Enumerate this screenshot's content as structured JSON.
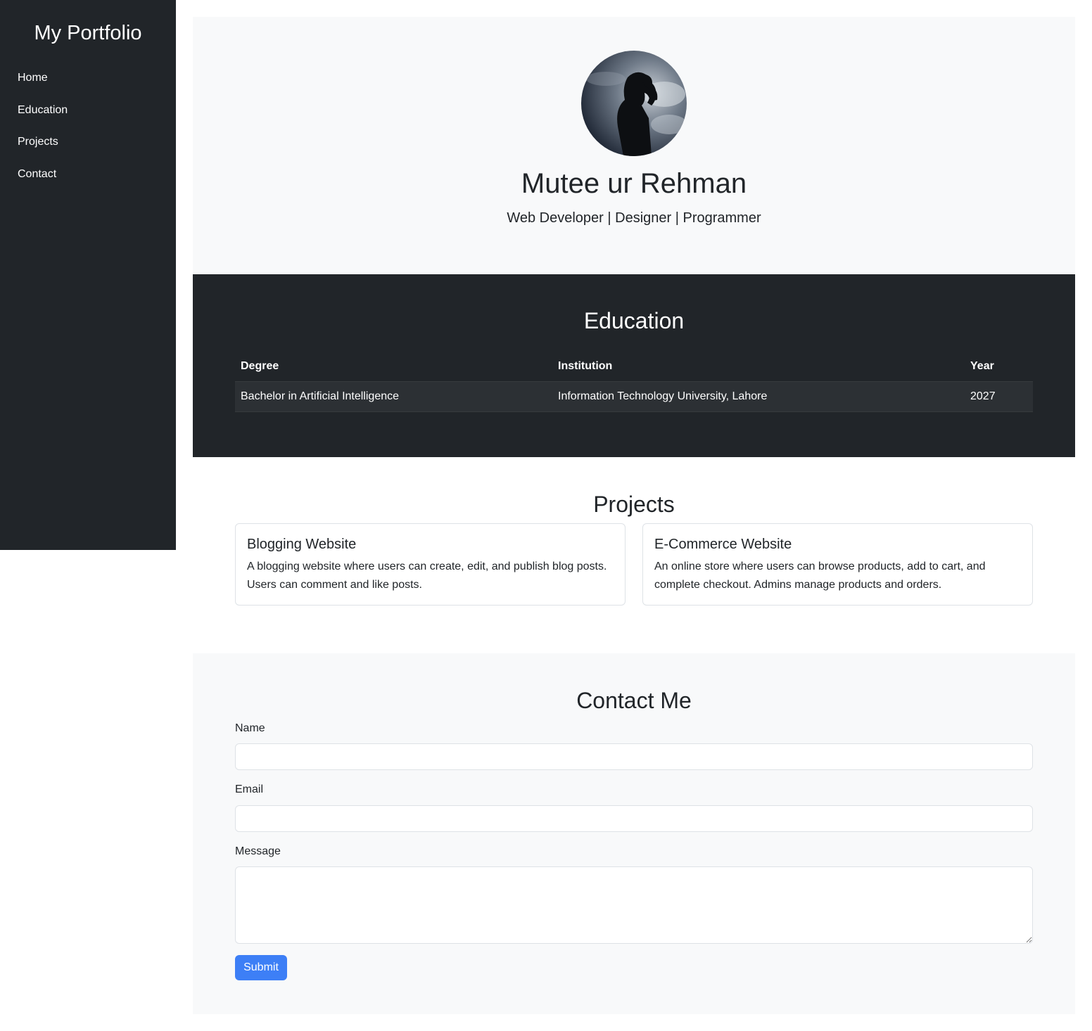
{
  "sidebar": {
    "brand": "My Portfolio",
    "items": [
      {
        "label": "Home"
      },
      {
        "label": "Education"
      },
      {
        "label": "Projects"
      },
      {
        "label": "Contact"
      }
    ]
  },
  "hero": {
    "name": "Mutee ur Rehman",
    "tagline": "Web Developer | Designer | Programmer"
  },
  "education": {
    "title": "Education",
    "headers": [
      "Degree",
      "Institution",
      "Year"
    ],
    "rows": [
      [
        "Bachelor in Artificial Intelligence",
        "Information Technology University, Lahore",
        "2027"
      ]
    ]
  },
  "projects": {
    "title": "Projects",
    "cards": [
      {
        "title": "Blogging Website",
        "text": "A blogging website where users can create, edit, and publish blog posts. Users can comment and like posts."
      },
      {
        "title": "E-Commerce Website",
        "text": "An online store where users can browse products, add to cart, and complete checkout. Admins manage products and orders."
      }
    ]
  },
  "contact": {
    "title": "Contact Me",
    "name_label": "Name",
    "name_value": "",
    "email_label": "Email",
    "email_value": "",
    "message_label": "Message",
    "message_value": "",
    "submit_label": "Submit"
  },
  "colors": {
    "dark": "#212529",
    "light_bg": "#f8f9fa",
    "primary": "#3d7ff6"
  }
}
